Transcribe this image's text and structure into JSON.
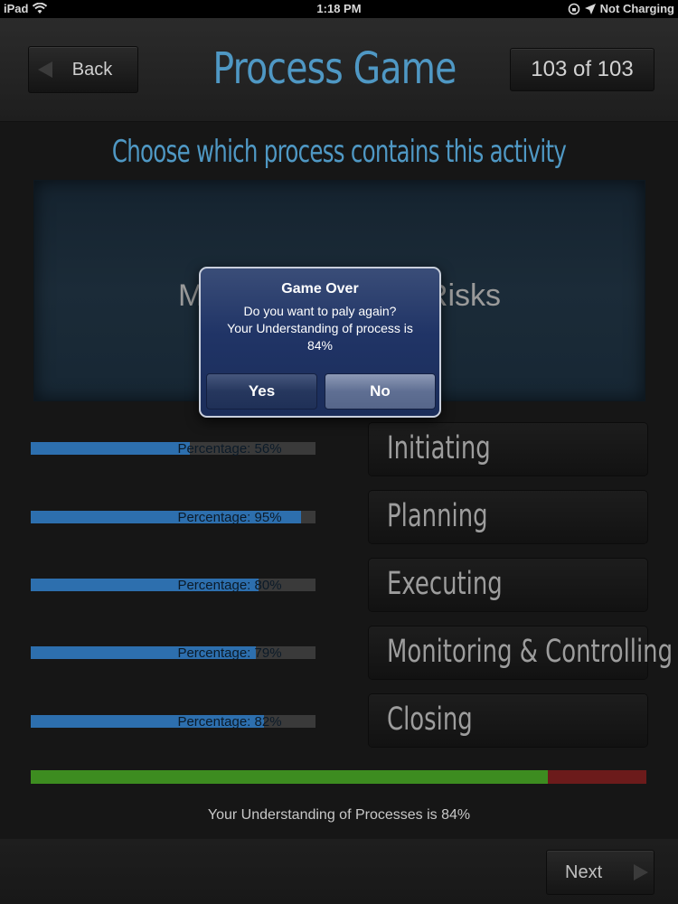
{
  "status_bar": {
    "device": "iPad",
    "time": "1:18 PM",
    "battery_text": "Not Charging"
  },
  "header": {
    "back_label": "Back",
    "title": "Process Game",
    "counter": "103 of 103"
  },
  "prompt": "Choose which process contains this activity",
  "activity": "Monitor & Control Risks",
  "stats": [
    {
      "label": "Percentage: 56%",
      "value": 56
    },
    {
      "label": "Percentage: 95%",
      "value": 95
    },
    {
      "label": "Percentage: 80%",
      "value": 80
    },
    {
      "label": "Percentage: 79%",
      "value": 79
    },
    {
      "label": "Percentage: 82%",
      "value": 82
    }
  ],
  "processes": [
    "Initiating",
    "Planning",
    "Executing",
    "Monitoring & Controlling",
    "Closing"
  ],
  "overall": {
    "value": 84,
    "text": "Your Understanding of Processes is 84%"
  },
  "footer": {
    "next_label": "Next"
  },
  "alert": {
    "title": "Game Over",
    "message": "Do you want to paly again?\nYour Understanding of process is\n84%",
    "yes_label": "Yes",
    "no_label": "No"
  },
  "colors": {
    "accent": "#4f98c4",
    "bar_fill": "#2d6fae",
    "overall_good": "#3d8c20",
    "overall_bad": "#6c1b1b"
  }
}
